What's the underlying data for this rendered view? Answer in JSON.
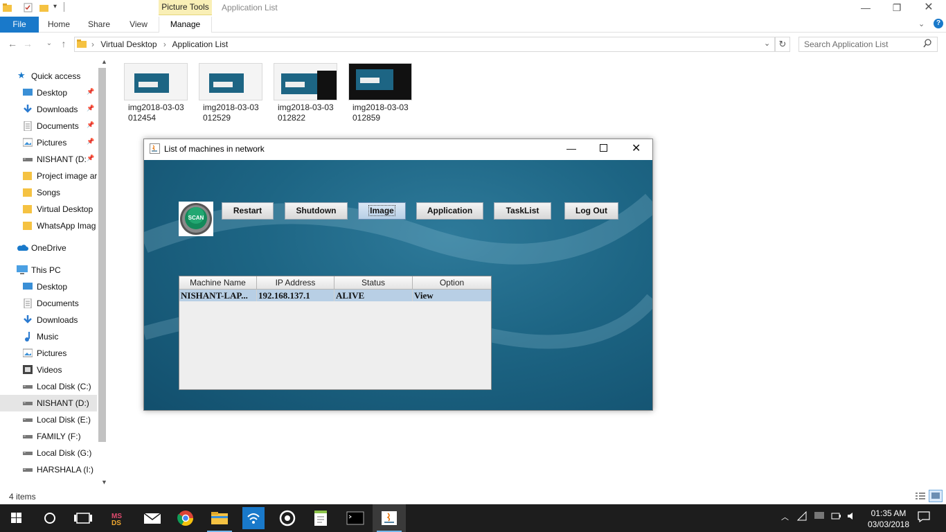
{
  "titlebar": {
    "context_tab": "Picture Tools",
    "window_title": "Application List"
  },
  "ribbon": {
    "tabs": [
      "File",
      "Home",
      "Share",
      "View",
      "Manage"
    ]
  },
  "address": {
    "path": [
      "Virtual Desktop",
      "Application List"
    ],
    "search_placeholder": "Search Application List"
  },
  "nav": {
    "quick_access": "Quick access",
    "quick_items": [
      {
        "label": "Desktop",
        "icon": "desktop-icon",
        "pinned": true
      },
      {
        "label": "Downloads",
        "icon": "download-icon",
        "pinned": true
      },
      {
        "label": "Documents",
        "icon": "documents-icon",
        "pinned": true
      },
      {
        "label": "Pictures",
        "icon": "pictures-icon",
        "pinned": true
      },
      {
        "label": "NISHANT (D:",
        "icon": "drive-icon",
        "pinned": true
      },
      {
        "label": "Project image ar",
        "icon": "folder-icon",
        "pinned": false
      },
      {
        "label": "Songs",
        "icon": "folder-icon",
        "pinned": false
      },
      {
        "label": "Virtual Desktop",
        "icon": "folder-icon",
        "pinned": false
      },
      {
        "label": "WhatsApp Imag",
        "icon": "folder-icon",
        "pinned": false
      }
    ],
    "onedrive": "OneDrive",
    "this_pc": "This PC",
    "pc_items": [
      {
        "label": "Desktop",
        "icon": "desktop-icon"
      },
      {
        "label": "Documents",
        "icon": "documents-icon"
      },
      {
        "label": "Downloads",
        "icon": "download-icon"
      },
      {
        "label": "Music",
        "icon": "music-icon"
      },
      {
        "label": "Pictures",
        "icon": "pictures-icon"
      },
      {
        "label": "Videos",
        "icon": "videos-icon"
      },
      {
        "label": "Local Disk (C:)",
        "icon": "drive-icon"
      },
      {
        "label": "NISHANT (D:)",
        "icon": "drive-icon",
        "selected": true
      },
      {
        "label": "Local Disk (E:)",
        "icon": "drive-icon"
      },
      {
        "label": "FAMILY (F:)",
        "icon": "drive-icon"
      },
      {
        "label": "Local Disk (G:)",
        "icon": "drive-icon"
      },
      {
        "label": "HARSHALA (I:)",
        "icon": "drive-icon"
      }
    ]
  },
  "files": [
    {
      "line1": "img2018-03-03",
      "line2": "012454"
    },
    {
      "line1": "img2018-03-03",
      "line2": "012529"
    },
    {
      "line1": "img2018-03-03",
      "line2": "012822"
    },
    {
      "line1": "img2018-03-03",
      "line2": "012859"
    }
  ],
  "status": {
    "item_count": "4 items"
  },
  "java_window": {
    "title": "List of machines in network",
    "scan_label": "SCAN",
    "buttons": [
      "Restart",
      "Shutdown",
      "Image",
      "Application",
      "TaskList",
      "Log Out"
    ],
    "active_button": "Image",
    "table": {
      "columns": [
        "Machine Name",
        "IP Address",
        "Status",
        "Option"
      ],
      "rows": [
        [
          "NISHANT-LAP...",
          "192.168.137.1",
          "ALIVE",
          "View"
        ]
      ]
    }
  },
  "taskbar": {
    "time": "01:35 AM",
    "date": "03/03/2018",
    "apps": [
      "start-icon",
      "cortana-icon",
      "task-view-icon",
      "ms-app-icon",
      "mail-icon",
      "chrome-icon",
      "file-explorer-icon",
      "wifi-app-icon",
      "groove-icon",
      "notepad-icon",
      "cmd-icon",
      "java-icon"
    ]
  },
  "colors": {
    "file_tab": "#1979ca",
    "picture_tools": "#f9efb6",
    "java_bg": "#1d6584",
    "table_selection": "#b8cfe5",
    "taskbar": "#1d1d1d"
  }
}
